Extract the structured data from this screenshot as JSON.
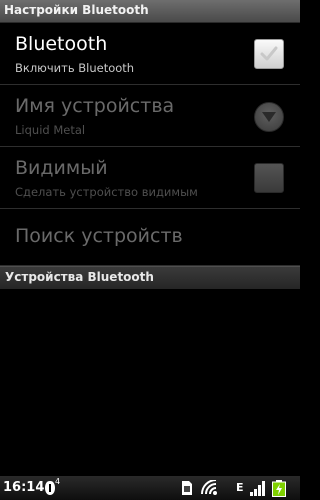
{
  "window": {
    "title": "Настройки Bluetooth"
  },
  "preferences": [
    {
      "label": "Bluetooth",
      "summary": "Включить Bluetooth",
      "enabled": true,
      "checked": true
    },
    {
      "label": "Имя устройства",
      "summary": "Liquid Metal",
      "enabled": false
    },
    {
      "label": "Видимый",
      "summary": "Сделать устройство видимым",
      "enabled": false,
      "checked": false
    }
  ],
  "search": {
    "label": "Поиск устройств",
    "enabled": false
  },
  "devices_section": {
    "header": "Устройства Bluetooth"
  },
  "status_bar": {
    "time": "16:14",
    "notification_badge": "4",
    "network_type": "E",
    "icons": [
      "notification-icon",
      "sim-icon",
      "wifi-icon",
      "signal-icon",
      "battery-charging-icon"
    ]
  },
  "colors": {
    "title_bar": "#5a5a5a",
    "background": "#000000",
    "text_enabled": "#ffffff",
    "text_disabled": "#6a6a6a",
    "battery": "#7fd000"
  }
}
